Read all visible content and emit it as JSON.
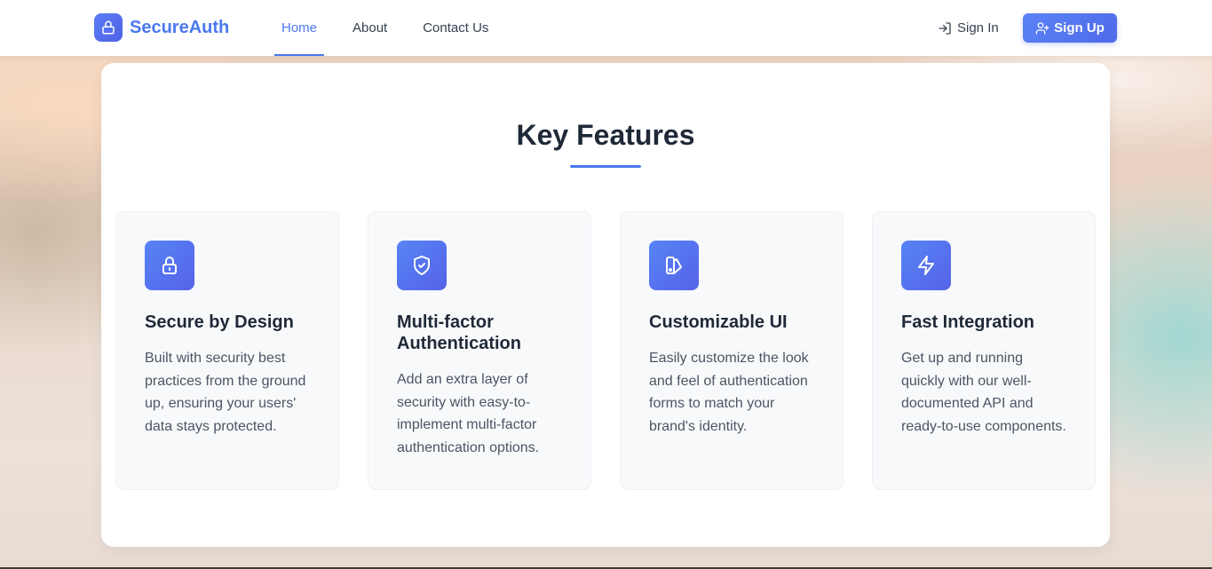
{
  "header": {
    "brand_name": "SecureAuth",
    "nav": [
      {
        "label": "Home",
        "active": true
      },
      {
        "label": "About",
        "active": false
      },
      {
        "label": "Contact Us",
        "active": false
      }
    ],
    "sign_in_label": "Sign In",
    "sign_up_label": "Sign Up"
  },
  "features": {
    "title": "Key Features",
    "items": [
      {
        "icon": "lock-icon",
        "title": "Secure by Design",
        "description": "Built with security best practices from the ground up, ensuring your users' data stays protected."
      },
      {
        "icon": "shield-check-icon",
        "title": "Multi-factor Authentication",
        "description": "Add an extra layer of security with easy-to-implement multi-factor authentication options."
      },
      {
        "icon": "palette-icon",
        "title": "Customizable UI",
        "description": "Easily customize the look and feel of authentication forms to match your brand's identity."
      },
      {
        "icon": "lightning-icon",
        "title": "Fast Integration",
        "description": "Get up and running quickly with our well-documented API and ready-to-use components."
      }
    ]
  },
  "colors": {
    "accent": "#4a78ee",
    "icon_gradient_start": "#5784f6",
    "icon_gradient_end": "#5563e8",
    "heading": "#1f2937",
    "body_text": "#4b5563"
  }
}
